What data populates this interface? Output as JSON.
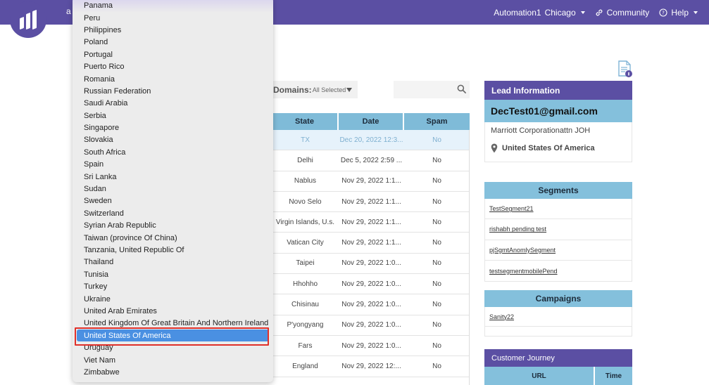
{
  "topbar": {
    "app_fragment": "a",
    "workspace": "Automation1",
    "location": "Chicago",
    "community": "Community",
    "help": "Help"
  },
  "filter": {
    "domains_label": "Domains:",
    "domains_value": "All Selected",
    "search_value": ""
  },
  "table": {
    "headers": {
      "state": "State",
      "date": "Date",
      "spam": "Spam"
    },
    "rows": [
      {
        "state": "TX",
        "date": "Dec 20, 2022 12:3...",
        "spam": "No"
      },
      {
        "state": "Delhi",
        "date": "Dec 5, 2022 2:59 ...",
        "spam": "No"
      },
      {
        "state": "Nablus",
        "date": "Nov 29, 2022 1:1...",
        "spam": "No"
      },
      {
        "state": "Novo Selo",
        "date": "Nov 29, 2022 1:1...",
        "spam": "No"
      },
      {
        "state": "Virgin Islands, U.s.",
        "date": "Nov 29, 2022 1:1...",
        "spam": "No"
      },
      {
        "state": "Vatican City",
        "date": "Nov 29, 2022 1:1...",
        "spam": "No"
      },
      {
        "state": "Taipei",
        "date": "Nov 29, 2022 1:0...",
        "spam": "No"
      },
      {
        "state": "Hhohho",
        "date": "Nov 29, 2022 1:0...",
        "spam": "No"
      },
      {
        "state": "Chisinau",
        "date": "Nov 29, 2022 1:0...",
        "spam": "No"
      },
      {
        "state": "P'yongyang",
        "date": "Nov 29, 2022 1:0...",
        "spam": "No"
      },
      {
        "state": "Fars",
        "date": "Nov 29, 2022 1:0...",
        "spam": "No"
      },
      {
        "state": "England",
        "date": "Nov 29, 2022 12:...",
        "spam": "No"
      }
    ]
  },
  "lead": {
    "title": "Lead Information",
    "email": "DecTest01@gmail.com",
    "company": "Marriott  Corporationattn  JOH",
    "country": "United States Of America"
  },
  "segments": {
    "title": "Segments",
    "items": [
      "TestSegment21",
      "rishabh pending test",
      "pjSgmtAnomlySegment",
      "testsegmentmobilePend"
    ]
  },
  "campaigns": {
    "title": "Campaigns",
    "items": [
      "Sanity22"
    ]
  },
  "customer_journey": {
    "title": "Customer Journey",
    "headers": {
      "url": "URL",
      "time": "Time"
    }
  },
  "dropdown": {
    "options": [
      "Panama",
      "Peru",
      "Philippines",
      "Poland",
      "Portugal",
      "Puerto Rico",
      "Romania",
      "Russian Federation",
      "Saudi Arabia",
      "Serbia",
      "Singapore",
      "Slovakia",
      "South Africa",
      "Spain",
      "Sri Lanka",
      "Sudan",
      "Sweden",
      "Switzerland",
      "Syrian Arab Republic",
      "Taiwan (province Of China)",
      "Tanzania, United Republic Of",
      "Thailand",
      "Tunisia",
      "Turkey",
      "Ukraine",
      "United Arab Emirates",
      "United Kingdom Of Great Britain And Northern Ireland",
      "United States Of America",
      "Uruguay",
      "Viet Nam",
      "Zimbabwe"
    ],
    "selected": "United States Of America"
  },
  "colors": {
    "brand_purple": "#5b4fa3",
    "header_blue": "#84c0dc",
    "selection_blue": "#4a90e2",
    "annotation_red": "#e0302a"
  }
}
